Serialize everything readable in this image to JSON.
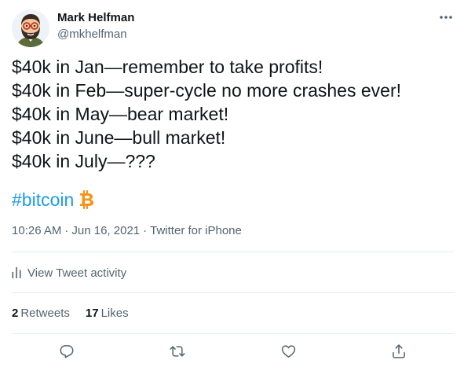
{
  "author": {
    "display_name": "Mark Helfman",
    "handle": "@mkhelfman",
    "avatar_icon": "bearded-man-with-glasses-avatar"
  },
  "tweet": {
    "lines": [
      "$40k in Jan—remember to take profits!",
      "$40k in Feb—super-cycle no more crashes ever!",
      "$40k in May—bear market!",
      "$40k in June—bull market!",
      "$40k in July—???"
    ],
    "hashtag": "#bitcoin",
    "hashtag_icon": "bitcoin-icon"
  },
  "meta": {
    "time": "10:26 AM",
    "separator": "·",
    "date": "Jun 16, 2021",
    "source": "Twitter for iPhone"
  },
  "activity": {
    "label": "View Tweet activity",
    "icon": "analytics-icon"
  },
  "stats": {
    "retweets_count": "2",
    "retweets_label": "Retweets",
    "likes_count": "17",
    "likes_label": "Likes"
  },
  "actions": [
    "reply-icon",
    "retweet-icon",
    "like-icon",
    "share-icon"
  ],
  "colors": {
    "text": "#0f1419",
    "secondary": "#536471",
    "link": "#1d9bf0",
    "divider": "#e6ecf0",
    "bitcoin": "#f7931a"
  }
}
